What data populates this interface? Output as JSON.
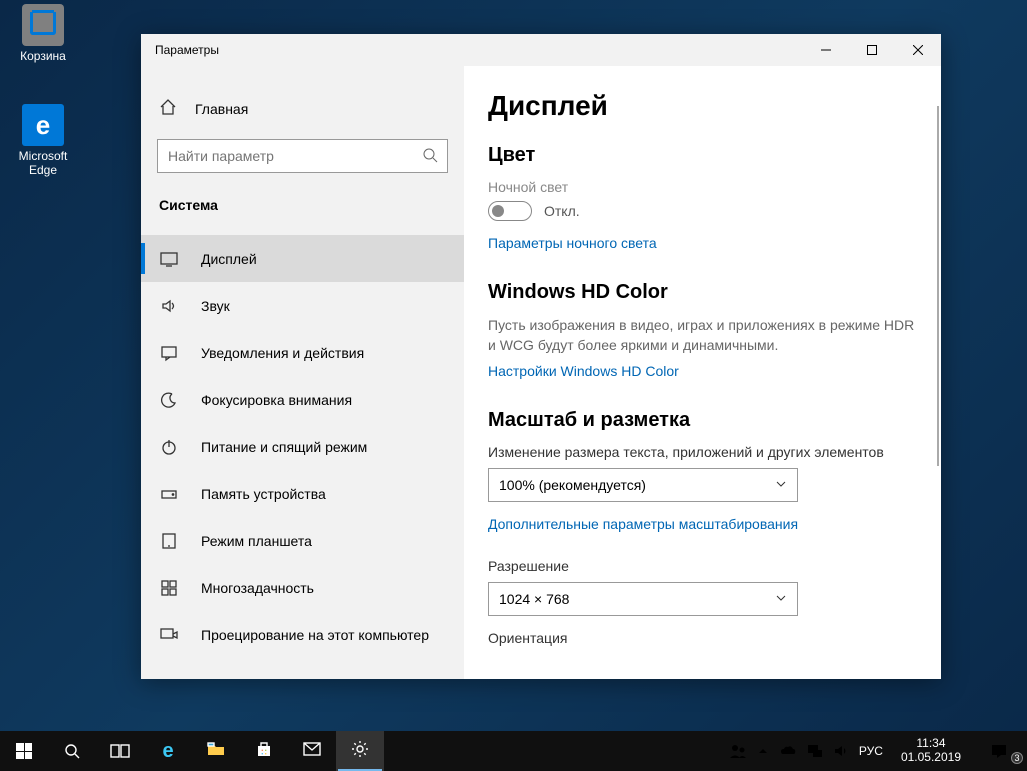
{
  "desktop": {
    "icons": [
      {
        "label": "Корзина"
      },
      {
        "label": "Microsoft Edge"
      }
    ]
  },
  "window": {
    "title": "Параметры",
    "home": "Главная",
    "search_placeholder": "Найти параметр",
    "section": "Система",
    "nav": [
      {
        "label": "Дисплей",
        "selected": true
      },
      {
        "label": "Звук"
      },
      {
        "label": "Уведомления и действия"
      },
      {
        "label": "Фокусировка внимания"
      },
      {
        "label": "Питание и спящий режим"
      },
      {
        "label": "Память устройства"
      },
      {
        "label": "Режим планшета"
      },
      {
        "label": "Многозадачность"
      },
      {
        "label": "Проецирование на этот компьютер"
      }
    ]
  },
  "content": {
    "page_title": "Дисплей",
    "color_heading": "Цвет",
    "night_light_label": "Ночной свет",
    "night_light_state": "Откл.",
    "night_light_link": "Параметры ночного света",
    "hd_heading": "Windows HD Color",
    "hd_desc": "Пусть изображения в видео, играх и приложениях в режиме HDR и WCG будут более яркими и динамичными.",
    "hd_link": "Настройки Windows HD Color",
    "scale_heading": "Масштаб и разметка",
    "scale_label": "Изменение размера текста, приложений и других элементов",
    "scale_value": "100% (рекомендуется)",
    "scale_link": "Дополнительные параметры масштабирования",
    "resolution_label": "Разрешение",
    "resolution_value": "1024 × 768",
    "orientation_label": "Ориентация"
  },
  "taskbar": {
    "lang": "РУС",
    "time": "11:34",
    "date": "01.05.2019",
    "notif_count": "3"
  }
}
